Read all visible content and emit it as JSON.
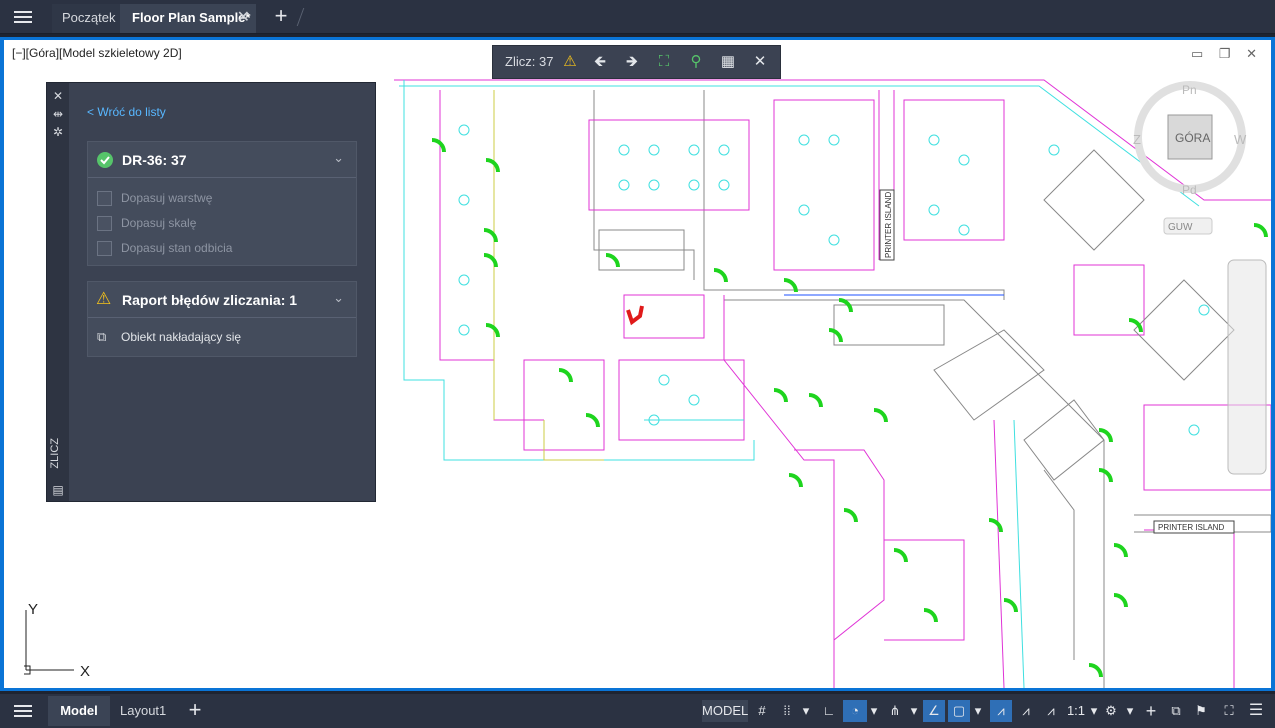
{
  "tabs": {
    "start": "Początek",
    "active": "Floor Plan Sample*",
    "close": "✕",
    "add": "+"
  },
  "viewport": {
    "label": "[−][Góra][Model szkieletowy 2D]",
    "window_controls": "▭ ❐ ✕"
  },
  "count_toolbar": {
    "label": "Zlicz:",
    "value": "37",
    "icons": [
      "warning-icon",
      "arrow-left-icon",
      "arrow-right-icon",
      "zoom-extents-icon",
      "find-icon",
      "table-icon",
      "close-icon"
    ]
  },
  "viewcube": {
    "face": "GÓRA",
    "north": "Pn",
    "south": "Pd",
    "west": "W",
    "east": "Z",
    "ucs": "GUW"
  },
  "panel": {
    "back": "< Wróć do listy",
    "vertical_title": "ZLICZ",
    "group1": {
      "title": "DR-36: 37",
      "options": [
        "Dopasuj warstwę",
        "Dopasuj skalę",
        "Dopasuj stan odbicia"
      ]
    },
    "group2": {
      "title": "Raport błędów zliczania: 1",
      "item": "Obiekt nakładający się"
    }
  },
  "drawing": {
    "label1": "PRINTER ISLAND",
    "label2": "PRINTER ISLAND"
  },
  "ucs_axes": {
    "x": "X",
    "y": "Y"
  },
  "bottom": {
    "model_tab": "Model",
    "layout_tab": "Layout1",
    "add": "+",
    "model_btn": "MODEL",
    "scale": "1:1"
  },
  "colors": {
    "accent": "#0a74d6",
    "door": "#1ed41e",
    "magenta": "#e033d6",
    "cyan": "#3fe0e0",
    "error": "#e01a1a"
  }
}
